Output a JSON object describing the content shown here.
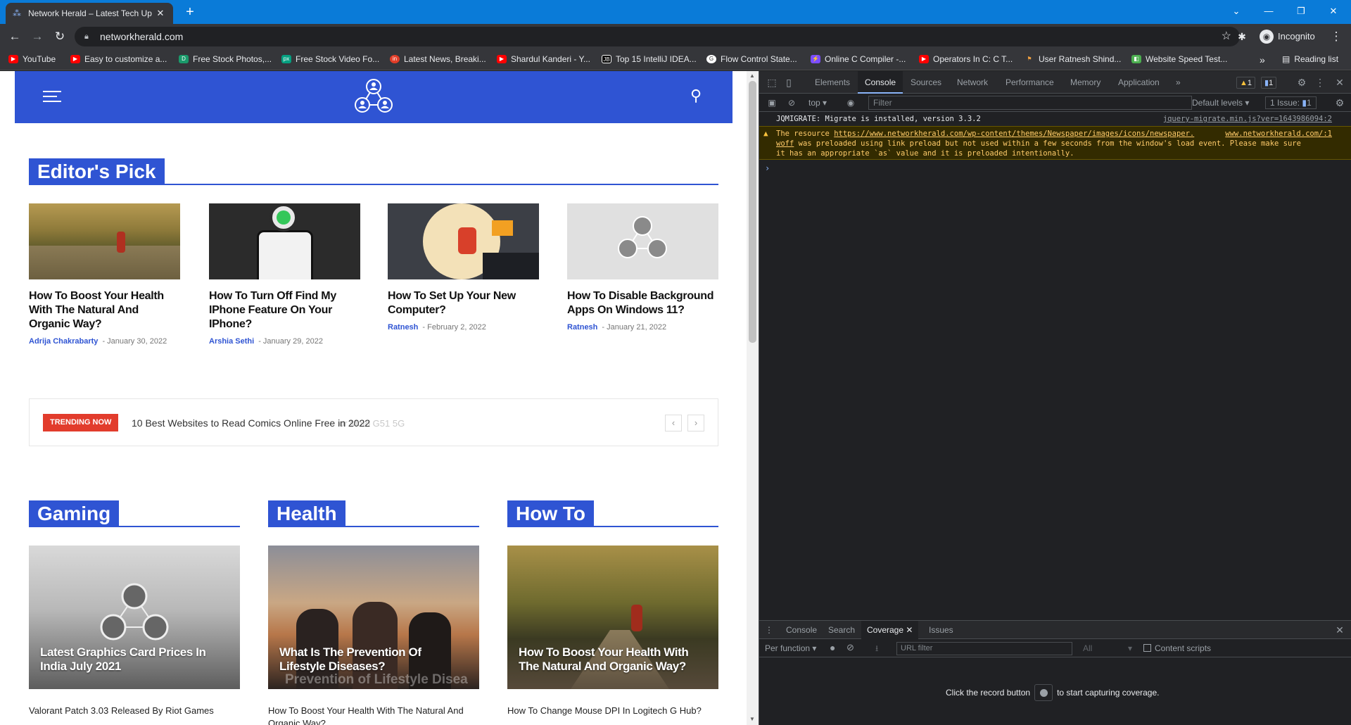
{
  "browser": {
    "tab_title": "Network Herald – Latest Tech Up",
    "tab_close": "✕",
    "new_tab": "+",
    "url": "networkherald.com",
    "incognito_label": "Incognito",
    "reading_list": "Reading list",
    "bookmarks_overflow": "»",
    "bookmarks": [
      {
        "label": "YouTube",
        "icon": "youtube-icon"
      },
      {
        "label": "Easy to customize a...",
        "icon": "youtube-icon"
      },
      {
        "label": "Free Stock Photos,...",
        "icon": "stock-photo-icon"
      },
      {
        "label": "Free Stock Video Fo...",
        "icon": "pexels-icon"
      },
      {
        "label": "Latest News, Breaki...",
        "icon": "news-icon"
      },
      {
        "label": "Shardul Kanderi - Y...",
        "icon": "youtube-icon"
      },
      {
        "label": "Top 15 IntelliJ IDEA...",
        "icon": "jetbrains-icon"
      },
      {
        "label": "Flow Control State...",
        "icon": "g-icon"
      },
      {
        "label": "Online C Compiler -...",
        "icon": "compiler-icon"
      },
      {
        "label": "Operators In C: C T...",
        "icon": "youtube-icon"
      },
      {
        "label": "User Ratnesh Shind...",
        "icon": "user-icon"
      },
      {
        "label": "Website Speed Test...",
        "icon": "speed-test-icon"
      }
    ]
  },
  "site": {
    "brand_color": "#2f54d3",
    "editors_pick": {
      "title": "Editor's Pick",
      "cards": [
        {
          "title": "How To Boost Your Health With The Natural And Organic Way?",
          "author": "Adrija Chakrabarty",
          "date": "January 30, 2022"
        },
        {
          "title": "How To Turn Off Find My IPhone Feature On Your IPhone?",
          "author": "Arshia Sethi",
          "date": "January 29, 2022"
        },
        {
          "title": "How To Set Up Your New Computer?",
          "author": "Ratnesh",
          "date": "February 2, 2022"
        },
        {
          "title": "How To Disable Background Apps On Windows 11?",
          "author": "Ratnesh",
          "date": "January 21, 2022"
        }
      ]
    },
    "trending": {
      "badge": "TRENDING NOW",
      "text": "10 Best Websites to Read Comics Online Free in 2022",
      "ghost_text": "or Moto G51 5G",
      "prev": "‹",
      "next": "›"
    },
    "sections": [
      {
        "title": "Gaming",
        "feature": "Latest Graphics Card Prices In India July 2021",
        "item": "Valorant Patch 3.03 Released By Riot Games"
      },
      {
        "title": "Health",
        "feature": "What Is The Prevention Of Lifestyle Diseases?",
        "overlay": "Prevention of Lifestyle Disea",
        "item": "How To Boost Your Health With The Natural And Organic Way?"
      },
      {
        "title": "How To",
        "feature": "How To Boost Your Health With The Natural And Organic Way?",
        "item": "How To Change Mouse DPI In Logitech G Hub?"
      }
    ]
  },
  "devtools": {
    "tabs": [
      "Elements",
      "Console",
      "Sources",
      "Network",
      "Performance",
      "Memory",
      "Application"
    ],
    "active_tab": "Console",
    "more": "»",
    "warn_count": "1",
    "msg_count": "1",
    "context": "top",
    "filter_placeholder": "Filter",
    "levels": "Default levels",
    "issues": "1 Issue:",
    "issues_count": "1",
    "console": {
      "line1": "JQMIGRATE: Migrate is installed, version 3.3.2",
      "line1_source": "jquery-migrate.min.js?ver=1643986094:2",
      "warn_pre": "The resource ",
      "warn_url": "https://www.networkherald.com/wp-content/themes/Newspaper/images/icons/newspaper.",
      "warn_source": "www.networkherald.com/:1",
      "warn_url2": "woff",
      "warn_rest": " was preloaded using link preload but not used within a few seconds from the window's load event. Please make sure",
      "warn_line3": "it has an appropriate `as` value and it is preloaded intentionally.",
      "prompt": "›"
    },
    "drawer": {
      "tabs": [
        "Console",
        "Search",
        "Coverage",
        "Issues"
      ],
      "active": "Coverage",
      "per_function": "Per function",
      "url_filter": "URL filter",
      "all": "All",
      "content_scripts": "Content scripts",
      "msg_pre": "Click the record button",
      "msg_post": "to start capturing coverage."
    }
  }
}
